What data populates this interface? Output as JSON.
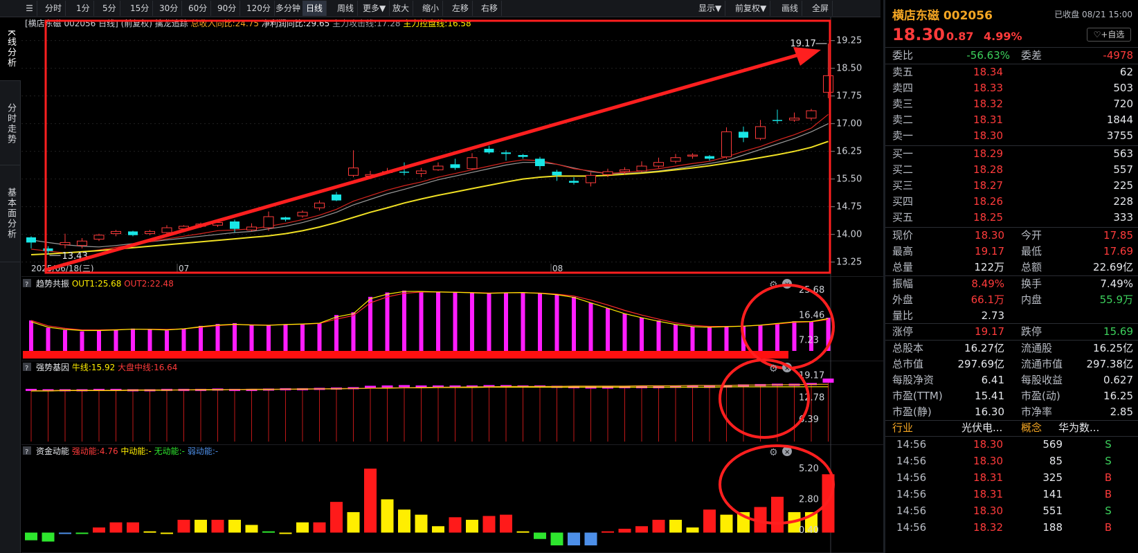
{
  "toolbar": {
    "periods": [
      "分时",
      "1分",
      "5分",
      "15分",
      "30分",
      "60分",
      "90分",
      "120分",
      "多分钟",
      "日线",
      "周线",
      "更多▼",
      "放大",
      "缩小",
      "左移",
      "右移"
    ],
    "active": "日线",
    "right": [
      "显示▼",
      "前复权▼",
      "画线",
      "全屏"
    ]
  },
  "sidebar": {
    "tabs": [
      "K线分析",
      "分时走势",
      "基本面分析"
    ]
  },
  "main_panel": {
    "header": "[横店东磁 002056 日线] (前复权)",
    "indicator": "擒龙追踪",
    "legend": [
      "总收入同比:24.75",
      "净利润同比:29.65",
      "主力攻击线:17.28",
      "主力控盘线:16.58"
    ],
    "yticks": [
      "19.25",
      "18.50",
      "17.75",
      "17.00",
      "16.25",
      "15.50",
      "14.75",
      "14.00",
      "13.25"
    ],
    "date_start": "2025/06/18(三)",
    "months": [
      "07",
      "08"
    ],
    "high_label": "19.17",
    "low_label": "13.43"
  },
  "panel2": {
    "title": "趋势共振",
    "legend": [
      "OUT1:25.68",
      "OUT2:22.48"
    ],
    "yticks": [
      "25.68",
      "16.46",
      "7.23"
    ]
  },
  "panel3": {
    "title": "强势基因",
    "legend": [
      "牛线:15.92",
      "大盘中线:16.64"
    ],
    "yticks": [
      "19.17",
      "12.78",
      "6.39"
    ]
  },
  "panel4": {
    "title": "资金动能",
    "legend": [
      "强动能:4.76",
      "中动能:-",
      "无动能:-",
      "弱动能:-"
    ],
    "yticks": [
      "5.20",
      "2.80",
      "0.40"
    ]
  },
  "colors": {
    "up": "#ff3b3b",
    "down": "#19e6e6",
    "ma1": "#d8251f",
    "ma2": "#9a9a9a",
    "ma3": "#f0e024",
    "magenta": "#ff1dff",
    "yellow": "#ffee00",
    "green": "#2ee62e",
    "blue": "#4d8fe8"
  },
  "chart_data": [
    {
      "type": "candlestick",
      "title": "横店东磁 002056 日线",
      "ylim": [
        13.0,
        19.6
      ],
      "series": [
        {
          "o": 13.92,
          "c": 13.78,
          "h": 13.95,
          "l": 13.62
        },
        {
          "o": 13.62,
          "c": 13.55,
          "h": 13.68,
          "l": 13.45
        },
        {
          "o": 13.72,
          "c": 13.78,
          "h": 14.02,
          "l": 13.62
        },
        {
          "o": 13.7,
          "c": 13.82,
          "h": 13.9,
          "l": 13.62
        },
        {
          "o": 13.87,
          "c": 13.98,
          "h": 14.02,
          "l": 13.82
        },
        {
          "o": 14.02,
          "c": 14.08,
          "h": 14.12,
          "l": 13.95
        },
        {
          "o": 14.08,
          "c": 13.98,
          "h": 14.1,
          "l": 13.95
        },
        {
          "o": 14.02,
          "c": 14.08,
          "h": 14.12,
          "l": 13.98
        },
        {
          "o": 14.05,
          "c": 14.18,
          "h": 14.25,
          "l": 14.0
        },
        {
          "o": 14.15,
          "c": 14.22,
          "h": 14.25,
          "l": 14.1
        },
        {
          "o": 14.22,
          "c": 14.28,
          "h": 14.32,
          "l": 14.18
        },
        {
          "o": 14.25,
          "c": 14.32,
          "h": 14.36,
          "l": 14.2
        },
        {
          "o": 14.35,
          "c": 14.15,
          "h": 14.4,
          "l": 14.05
        },
        {
          "o": 14.12,
          "c": 14.2,
          "h": 14.3,
          "l": 14.08
        },
        {
          "o": 14.18,
          "c": 14.48,
          "h": 14.62,
          "l": 14.1
        },
        {
          "o": 14.46,
          "c": 14.4,
          "h": 14.48,
          "l": 14.35
        },
        {
          "o": 14.5,
          "c": 14.6,
          "h": 14.65,
          "l": 14.45
        },
        {
          "o": 14.72,
          "c": 14.85,
          "h": 14.92,
          "l": 14.65
        },
        {
          "o": 15.08,
          "c": 14.92,
          "h": 15.15,
          "l": 14.9
        },
        {
          "o": 15.6,
          "c": 15.8,
          "h": 16.28,
          "l": 15.55
        },
        {
          "o": 15.58,
          "c": 15.62,
          "h": 15.72,
          "l": 15.5
        },
        {
          "o": 15.7,
          "c": 15.7,
          "h": 15.8,
          "l": 15.65
        },
        {
          "o": 15.7,
          "c": 15.68,
          "h": 15.95,
          "l": 15.6
        },
        {
          "o": 15.65,
          "c": 15.72,
          "h": 15.8,
          "l": 15.55
        },
        {
          "o": 15.75,
          "c": 15.85,
          "h": 15.95,
          "l": 15.72
        },
        {
          "o": 15.9,
          "c": 15.8,
          "h": 16.05,
          "l": 15.75
        },
        {
          "o": 15.78,
          "c": 16.08,
          "h": 16.2,
          "l": 15.75
        },
        {
          "o": 16.32,
          "c": 16.22,
          "h": 16.4,
          "l": 16.18
        },
        {
          "o": 16.22,
          "c": 16.18,
          "h": 16.28,
          "l": 16.0
        },
        {
          "o": 16.15,
          "c": 16.1,
          "h": 16.18,
          "l": 16.05
        },
        {
          "o": 16.05,
          "c": 15.85,
          "h": 16.1,
          "l": 15.75
        },
        {
          "o": 15.7,
          "c": 15.6,
          "h": 15.75,
          "l": 15.45
        },
        {
          "o": 15.45,
          "c": 15.4,
          "h": 15.55,
          "l": 15.35
        },
        {
          "o": 15.4,
          "c": 15.6,
          "h": 15.68,
          "l": 15.3
        },
        {
          "o": 15.62,
          "c": 15.7,
          "h": 15.78,
          "l": 15.55
        },
        {
          "o": 15.7,
          "c": 15.75,
          "h": 15.82,
          "l": 15.62
        },
        {
          "o": 15.72,
          "c": 15.85,
          "h": 15.98,
          "l": 15.68
        },
        {
          "o": 15.85,
          "c": 15.95,
          "h": 16.08,
          "l": 15.8
        },
        {
          "o": 15.98,
          "c": 16.08,
          "h": 16.18,
          "l": 15.92
        },
        {
          "o": 16.12,
          "c": 16.15,
          "h": 16.2,
          "l": 16.05
        },
        {
          "o": 16.12,
          "c": 16.05,
          "h": 16.15,
          "l": 16.0
        },
        {
          "o": 16.1,
          "c": 16.78,
          "h": 16.9,
          "l": 16.05
        },
        {
          "o": 16.78,
          "c": 16.62,
          "h": 16.92,
          "l": 16.5
        },
        {
          "o": 16.6,
          "c": 16.92,
          "h": 17.1,
          "l": 16.55
        },
        {
          "o": 17.1,
          "c": 17.08,
          "h": 17.38,
          "l": 17.0
        },
        {
          "o": 17.1,
          "c": 17.15,
          "h": 17.3,
          "l": 17.05
        },
        {
          "o": 17.15,
          "c": 17.35,
          "h": 17.4,
          "l": 17.08
        },
        {
          "o": 17.85,
          "c": 18.3,
          "h": 19.17,
          "l": 17.69
        }
      ],
      "ma_short": [
        13.6,
        13.55,
        13.5,
        13.52,
        13.58,
        13.65,
        13.72,
        13.8,
        13.88,
        13.95,
        14.02,
        14.1,
        14.12,
        14.15,
        14.22,
        14.3,
        14.4,
        14.52,
        14.68,
        14.9,
        15.05,
        15.2,
        15.32,
        15.42,
        15.55,
        15.65,
        15.75,
        15.85,
        15.95,
        16.02,
        16.0,
        15.9,
        15.78,
        15.72,
        15.65,
        15.68,
        15.72,
        15.78,
        15.85,
        15.92,
        15.98,
        16.1,
        16.25,
        16.38,
        16.55,
        16.7,
        16.88,
        17.25
      ],
      "ma_mid": [
        13.85,
        13.78,
        13.72,
        13.68,
        13.66,
        13.7,
        13.75,
        13.8,
        13.85,
        13.9,
        13.95,
        14.0,
        14.05,
        14.08,
        14.15,
        14.22,
        14.32,
        14.45,
        14.6,
        14.8,
        14.95,
        15.1,
        15.22,
        15.35,
        15.48,
        15.58,
        15.68,
        15.78,
        15.88,
        15.95,
        15.95,
        15.9,
        15.8,
        15.7,
        15.65,
        15.65,
        15.68,
        15.72,
        15.78,
        15.85,
        15.92,
        16.0,
        16.15,
        16.3,
        16.45,
        16.6,
        16.78,
        17.0
      ],
      "ma_long": [
        13.45,
        13.47,
        13.5,
        13.53,
        13.56,
        13.6,
        13.64,
        13.68,
        13.72,
        13.76,
        13.8,
        13.84,
        13.88,
        13.92,
        13.96,
        14.02,
        14.1,
        14.2,
        14.32,
        14.46,
        14.6,
        14.72,
        14.85,
        14.96,
        15.06,
        15.15,
        15.24,
        15.33,
        15.42,
        15.5,
        15.55,
        15.58,
        15.58,
        15.58,
        15.6,
        15.63,
        15.66,
        15.7,
        15.75,
        15.8,
        15.86,
        15.93,
        16.0,
        16.08,
        16.16,
        16.25,
        16.36,
        16.52
      ]
    },
    {
      "type": "bar",
      "title": "趋势共振",
      "ylim": [
        2.0,
        27.0
      ],
      "values": [
        14.5,
        11.8,
        11.0,
        10.5,
        10.8,
        11.0,
        11.5,
        11.2,
        10.8,
        11.5,
        12.5,
        13.2,
        13.5,
        12.8,
        12.6,
        13.0,
        13.2,
        13.6,
        16.5,
        17.5,
        23.2,
        24.8,
        25.5,
        25.3,
        25.1,
        25.0,
        24.8,
        24.5,
        24.8,
        24.9,
        24.6,
        24.2,
        23.2,
        21.0,
        19.0,
        17.0,
        15.5,
        14.5,
        13.0,
        12.2,
        12.0,
        12.2,
        12.4,
        12.8,
        13.5,
        14.2,
        14.0,
        15.5,
        17.2,
        18.5,
        19.2,
        20.0,
        22.0,
        25.68
      ],
      "out1": [
        14.0,
        12.0,
        11.2,
        10.8,
        10.8,
        11.0,
        11.3,
        11.2,
        11.0,
        11.4,
        12.2,
        12.8,
        13.1,
        12.8,
        12.7,
        13.0,
        13.2,
        13.5,
        15.8,
        17.0,
        22.5,
        24.2,
        25.2,
        25.2,
        25.0,
        24.9,
        24.7,
        24.5,
        24.7,
        24.8,
        24.5,
        24.0,
        23.0,
        21.0,
        19.0,
        17.0,
        15.5,
        14.2,
        13.0,
        12.2,
        12.0,
        12.2,
        12.4,
        12.8,
        13.4,
        14.0,
        14.1,
        15.2,
        16.8,
        18.0,
        19.0,
        19.8,
        21.8,
        25.68
      ],
      "out2": [
        14.5,
        12.5,
        11.6,
        11.0,
        11.0,
        11.1,
        11.3,
        11.3,
        11.2,
        11.4,
        12.0,
        12.6,
        13.0,
        12.9,
        12.8,
        13.0,
        13.1,
        13.4,
        15.0,
        16.3,
        21.0,
        23.2,
        24.5,
        25.0,
        25.0,
        24.9,
        24.8,
        24.6,
        24.7,
        24.7,
        24.6,
        24.2,
        23.5,
        22.0,
        20.2,
        18.2,
        16.5,
        15.0,
        13.6,
        12.7,
        12.3,
        12.3,
        12.4,
        12.7,
        13.2,
        13.8,
        14.0,
        14.8,
        16.0,
        17.2,
        18.2,
        19.0,
        20.5,
        22.48
      ]
    },
    {
      "type": "bar",
      "title": "强势基因",
      "ylim": [
        0.0,
        20.5
      ],
      "values": [
        15.0,
        14.9,
        14.9,
        14.9,
        15.0,
        15.0,
        14.9,
        14.9,
        15.0,
        15.0,
        15.0,
        15.1,
        15.0,
        15.0,
        15.1,
        15.2,
        15.2,
        15.3,
        15.4,
        15.5,
        15.9,
        16.0,
        16.1,
        16.0,
        16.0,
        16.0,
        16.0,
        16.1,
        16.1,
        16.0,
        16.0,
        15.9,
        15.8,
        15.7,
        15.7,
        15.8,
        15.8,
        15.8,
        15.9,
        15.9,
        15.9,
        16.0,
        16.3,
        16.4,
        16.5,
        16.5,
        16.7,
        17.5
      ],
      "bull": [
        14.7,
        14.7,
        14.8,
        14.8,
        14.8,
        14.8,
        14.9,
        14.9,
        14.9,
        15.0,
        15.0,
        15.0,
        15.1,
        15.1,
        15.1,
        15.2,
        15.2,
        15.3,
        15.3,
        15.4,
        15.5,
        15.5,
        15.6,
        15.6,
        15.7,
        15.7,
        15.7,
        15.8,
        15.8,
        15.8,
        15.8,
        15.8,
        15.8,
        15.8,
        15.8,
        15.8,
        15.8,
        15.8,
        15.8,
        15.8,
        15.8,
        15.9,
        15.9,
        15.9,
        15.9,
        15.9,
        15.92,
        15.92
      ],
      "mid": [
        14.8,
        14.8,
        14.9,
        14.9,
        14.9,
        14.9,
        15.0,
        15.0,
        15.0,
        15.0,
        15.1,
        15.1,
        15.1,
        15.2,
        15.2,
        15.2,
        15.3,
        15.3,
        15.4,
        15.4,
        15.5,
        15.6,
        15.6,
        15.7,
        15.8,
        15.8,
        15.9,
        15.9,
        16.0,
        16.0,
        16.0,
        16.0,
        16.1,
        16.1,
        16.1,
        16.1,
        16.2,
        16.2,
        16.2,
        16.3,
        16.3,
        16.3,
        16.4,
        16.4,
        16.5,
        16.5,
        16.6,
        16.64
      ]
    },
    {
      "type": "bar",
      "title": "资金动能",
      "ylim": [
        -0.8,
        5.8
      ],
      "values": [
        -0.4,
        -0.5,
        0.2,
        0.2,
        0.6,
        1.0,
        1.0,
        0.3,
        0.1,
        1.2,
        1.2,
        1.2,
        1.2,
        0.8,
        0.3,
        0.1,
        1.0,
        1.0,
        2.6,
        1.8,
        5.2,
        2.8,
        2.0,
        1.6,
        0.7,
        1.4,
        1.2,
        1.5,
        1.6,
        0.3,
        -0.3,
        -0.8,
        -0.8,
        -0.8,
        0.3,
        0.5,
        0.7,
        1.2,
        1.2,
        0.6,
        2.0,
        1.6,
        1.8,
        2.2,
        3.0,
        1.8,
        1.8,
        4.76
      ],
      "colors": [
        "green",
        "green",
        "blue",
        "green",
        "red",
        "red",
        "red",
        "yellow",
        "yellow",
        "red",
        "yellow",
        "red",
        "yellow",
        "yellow",
        "green",
        "yellow",
        "yellow",
        "red",
        "red",
        "yellow",
        "red",
        "yellow",
        "yellow",
        "yellow",
        "yellow",
        "red",
        "yellow",
        "red",
        "red",
        "yellow",
        "green",
        "green",
        "blue",
        "blue",
        "red",
        "red",
        "red",
        "red",
        "yellow",
        "yellow",
        "red",
        "yellow",
        "yellow",
        "red",
        "red",
        "yellow",
        "yellow",
        "red"
      ]
    }
  ],
  "quote": {
    "name": "横店东磁",
    "code": "002056",
    "status": "已收盘 08/21 15:00",
    "price": "18.30",
    "change": "0.87",
    "pct": "4.99%",
    "add": "+自选",
    "webi_label": "委比",
    "webi": "-56.63%",
    "weicha_label": "委差",
    "weicha": "-4978",
    "asks": [
      {
        "l": "卖五",
        "p": "18.34",
        "v": "62"
      },
      {
        "l": "卖四",
        "p": "18.33",
        "v": "503"
      },
      {
        "l": "卖三",
        "p": "18.32",
        "v": "720"
      },
      {
        "l": "卖二",
        "p": "18.31",
        "v": "1844"
      },
      {
        "l": "卖一",
        "p": "18.30",
        "v": "3755"
      }
    ],
    "bids": [
      {
        "l": "买一",
        "p": "18.29",
        "v": "563"
      },
      {
        "l": "买二",
        "p": "18.28",
        "v": "557"
      },
      {
        "l": "买三",
        "p": "18.27",
        "v": "225"
      },
      {
        "l": "买四",
        "p": "18.26",
        "v": "228"
      },
      {
        "l": "买五",
        "p": "18.25",
        "v": "333"
      }
    ],
    "stats1": [
      [
        "现价",
        "18.30",
        "red",
        "今开",
        "17.85",
        "red"
      ],
      [
        "最高",
        "19.17",
        "red",
        "最低",
        "17.69",
        "red"
      ],
      [
        "总量",
        "122万",
        "wht",
        "总额",
        "22.69亿",
        "wht"
      ]
    ],
    "stats2": [
      [
        "振幅",
        "8.49%",
        "red",
        "换手",
        "7.49%",
        "wht"
      ],
      [
        "外盘",
        "66.1万",
        "red",
        "内盘",
        "55.9万",
        "grn"
      ],
      [
        "量比",
        "2.73",
        "wht",
        "",
        "",
        " wht"
      ]
    ],
    "stats3": [
      [
        "涨停",
        "19.17",
        "red",
        "跌停",
        "15.69",
        "grn"
      ]
    ],
    "stats4": [
      [
        "总股本",
        "16.27亿",
        "wht",
        "流通股",
        "16.25亿",
        "wht"
      ],
      [
        "总市值",
        "297.69亿",
        "wht",
        "流通市值",
        "297.38亿",
        "wht"
      ],
      [
        "每股净资",
        "6.41",
        "wht",
        "每股收益",
        "0.627",
        "wht"
      ],
      [
        "市盈(TTM)",
        "15.41",
        "wht",
        "市盈(动)",
        "16.25",
        "wht"
      ],
      [
        "市盈(静)",
        "16.30",
        "wht",
        "市净率",
        "2.85",
        "wht"
      ]
    ],
    "industry_label": "行业",
    "industry": "光伏电...",
    "concept_label": "概念",
    "concept": "华为数...",
    "ticks": [
      [
        "14:56",
        "18.30",
        "569",
        "S"
      ],
      [
        "14:56",
        "18.30",
        "85",
        "S"
      ],
      [
        "14:56",
        "18.31",
        "325",
        "B"
      ],
      [
        "14:56",
        "18.31",
        "141",
        "B"
      ],
      [
        "14:56",
        "18.30",
        "551",
        "S"
      ],
      [
        "14:56",
        "18.32",
        "188",
        "B"
      ]
    ]
  }
}
